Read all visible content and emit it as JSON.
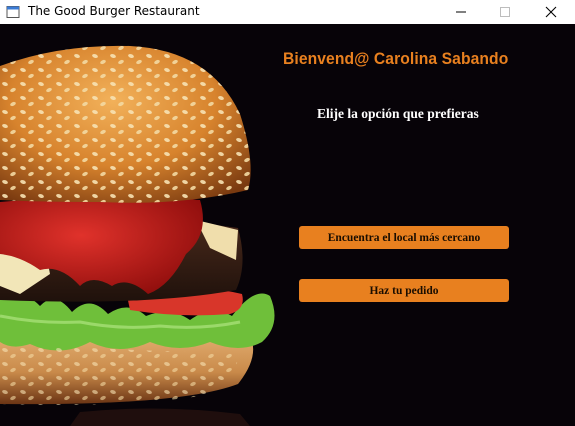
{
  "window": {
    "title": "The Good Burger Restaurant",
    "icon": "app-window-icon",
    "controls": {
      "minimize_icon": "minimize-icon",
      "maximize_icon": "maximize-icon",
      "close_icon": "close-icon"
    }
  },
  "main": {
    "welcome": "Bienvend@ Carolina Sabando",
    "prompt": "Elije la opción que prefieras",
    "buttons": {
      "nearest_location": "Encuentra el local más cercano",
      "order": "Haz tu pedido"
    },
    "image": "burger-photo"
  },
  "colors": {
    "accent": "#e8801f",
    "background": "#070308",
    "text": "#ffffff"
  }
}
